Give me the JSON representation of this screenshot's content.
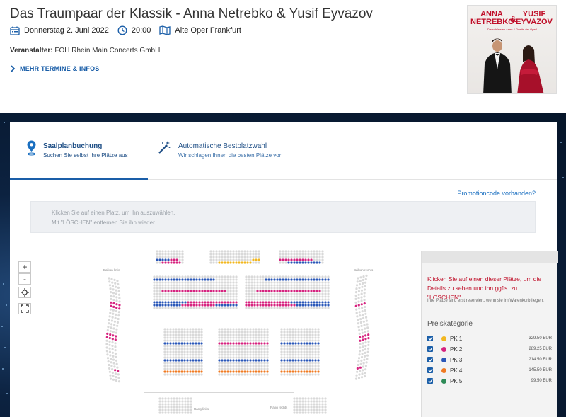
{
  "event": {
    "title": "Das Traumpaar der Klassik - Anna Netrebko & Yusif Eyvazov",
    "date": "Donnerstag 2. Juni 2022",
    "time": "20:00",
    "venue": "Alte Oper Frankfurt",
    "organizer_label": "Veranstalter:",
    "organizer": "FOH Rhein Main Concerts GmbH",
    "more_link": "MEHR TERMINE & INFOS"
  },
  "poster": {
    "name_left": "ANNA NETREBKO",
    "amp": "&",
    "name_right": "YUSIF EYVAZOV",
    "subtitle": "Die schönsten Arien & Duette der Oper!"
  },
  "tabs": [
    {
      "title": "Saalplanbuchung",
      "subtitle": "Suchen Sie selbst Ihre Plätze aus",
      "active": true
    },
    {
      "title": "Automatische Bestplatzwahl",
      "subtitle": "Wir schlagen Ihnen die besten Plätze vor",
      "active": false
    }
  ],
  "promo_link": "Promotioncode vorhanden?",
  "hint": {
    "line1": "Klicken Sie auf einen Platz, um ihn auszuwählen.",
    "line2": "Mit \"LÖSCHEN\" entfernen Sie ihn wieder."
  },
  "map_controls": {
    "zoom_in": "+",
    "zoom_out": "-"
  },
  "seatmap_labels": {
    "balkon_links": "Balkon links",
    "balkon_rechts": "Balkon rechts",
    "rang_links": "Rang links",
    "rang_rechts": "Rang rechts"
  },
  "side_panel": {
    "info": "Klicken Sie auf einen dieser Plätze, um die Details zu sehen und ihn ggfls. zu \"LÖSCHEN\".",
    "note": "Ihre Plätze sind erst reserviert, wenn sie im Warenkorb liegen.",
    "price_heading": "Preiskategorie"
  },
  "price_categories": [
    {
      "name": "PK 1",
      "price": "329.50 EUR",
      "color": "#f2b720",
      "checked": true
    },
    {
      "name": "PK 2",
      "price": "289.25 EUR",
      "color": "#d6237f",
      "checked": true
    },
    {
      "name": "PK 3",
      "price": "214.50 EUR",
      "color": "#2a57b8",
      "checked": true
    },
    {
      "name": "PK 4",
      "price": "145.50 EUR",
      "color": "#f07a22",
      "checked": true
    },
    {
      "name": "PK 5",
      "price": "99.50 EUR",
      "color": "#2e8b57",
      "checked": true
    }
  ],
  "colors": {
    "accent": "#1a5ea8",
    "brand_red": "#c0102a",
    "seat_empty": "#d9d9d9"
  }
}
